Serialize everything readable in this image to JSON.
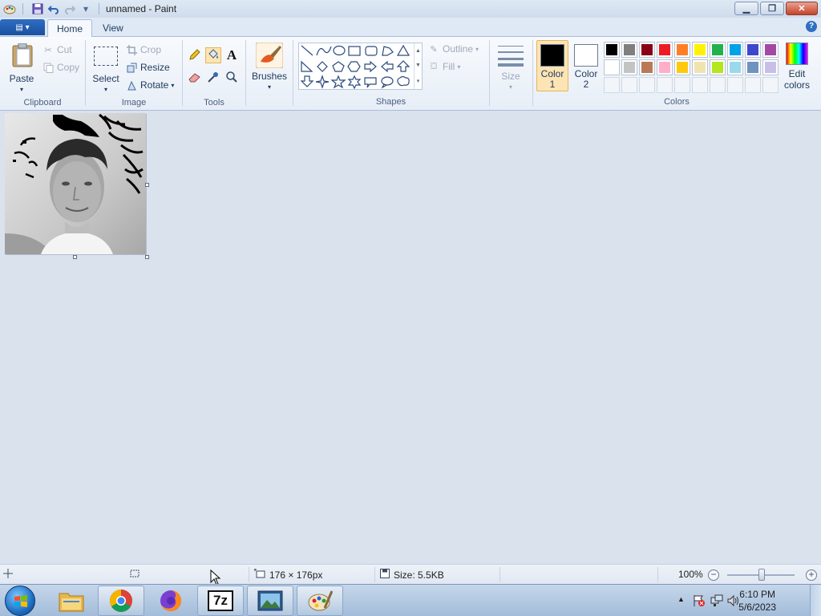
{
  "window": {
    "title": "unnamed - Paint"
  },
  "tabs": [
    {
      "label": "Home"
    },
    {
      "label": "View"
    }
  ],
  "clipboard": {
    "paste": "Paste",
    "cut": "Cut",
    "copy": "Copy",
    "group": "Clipboard"
  },
  "image": {
    "select": "Select",
    "crop": "Crop",
    "resize": "Resize",
    "rotate": "Rotate",
    "group": "Image"
  },
  "tools": {
    "group": "Tools",
    "items": [
      "pencil-icon",
      "fill-bucket-icon",
      "text-icon",
      "eraser-icon",
      "color-picker-icon",
      "magnifier-icon"
    ]
  },
  "brushes": {
    "label": "Brushes"
  },
  "shapes": {
    "outline": "Outline",
    "fill": "Fill",
    "group": "Shapes"
  },
  "size": {
    "label": "Size"
  },
  "colors": {
    "color1_label": "Color 1",
    "color1_line1": "Color",
    "color1_line2": "1",
    "color2_line1": "Color",
    "color2_line2": "2",
    "color1_value": "#000000",
    "color2_value": "#ffffff",
    "edit_line1": "Edit",
    "edit_line2": "colors",
    "group": "Colors",
    "palette_row1": [
      "#000000",
      "#7f7f7f",
      "#880015",
      "#ed1c24",
      "#ff7f27",
      "#fff200",
      "#22b14c",
      "#00a2e8",
      "#3f48cc",
      "#a349a4"
    ],
    "palette_row2": [
      "#ffffff",
      "#c3c3c3",
      "#b97a57",
      "#ffaec9",
      "#ffc90e",
      "#efe4b0",
      "#b5e61d",
      "#99d9ea",
      "#7092be",
      "#c8bfe7"
    ]
  },
  "status": {
    "dimensions": "176 × 176px",
    "size": "Size: 5.5KB",
    "zoom": "100%"
  },
  "taskbar": {
    "apps": [
      "explorer-icon",
      "chrome-icon",
      "firefox-icon",
      "7zip-icon",
      "photo-viewer-icon",
      "paint-icon"
    ],
    "sevenzip_text": "7z",
    "time": "6:10 PM",
    "date": "5/6/2023"
  }
}
